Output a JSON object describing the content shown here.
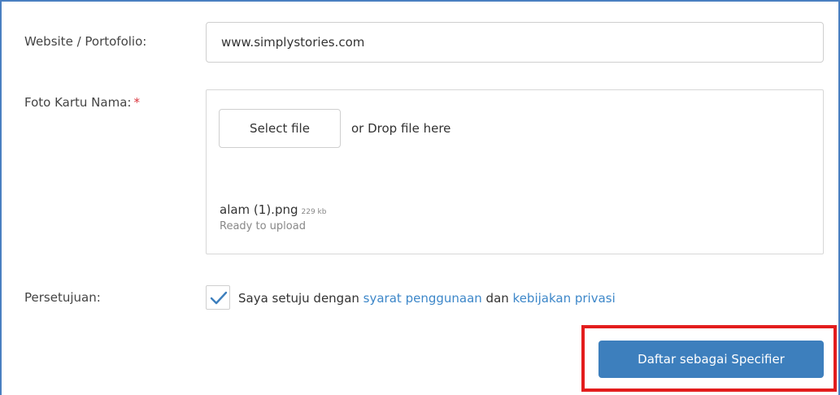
{
  "website_field": {
    "label": "Website / Portofolio:",
    "value": "www.simplystories.com"
  },
  "card_photo_field": {
    "label": "Foto Kartu Nama:",
    "required_marker": "*",
    "select_button_label": "Select file",
    "drop_hint": "or Drop file here",
    "file": {
      "name": "alam (1).png",
      "size": "229 kb",
      "status": "Ready to upload"
    }
  },
  "consent_field": {
    "label": "Persetujuan:",
    "checked": true,
    "text_before": "Saya setuju dengan ",
    "terms_link": "syarat penggunaan",
    "text_middle": " dan ",
    "privacy_link": "kebijakan privasi"
  },
  "submit": {
    "label": "Daftar sebagai Specifier"
  },
  "colors": {
    "accent": "#3d7fbd",
    "link": "#3d87c9",
    "highlight": "#e31d1d",
    "required": "#d9363e",
    "frame": "#4a7fc1"
  }
}
